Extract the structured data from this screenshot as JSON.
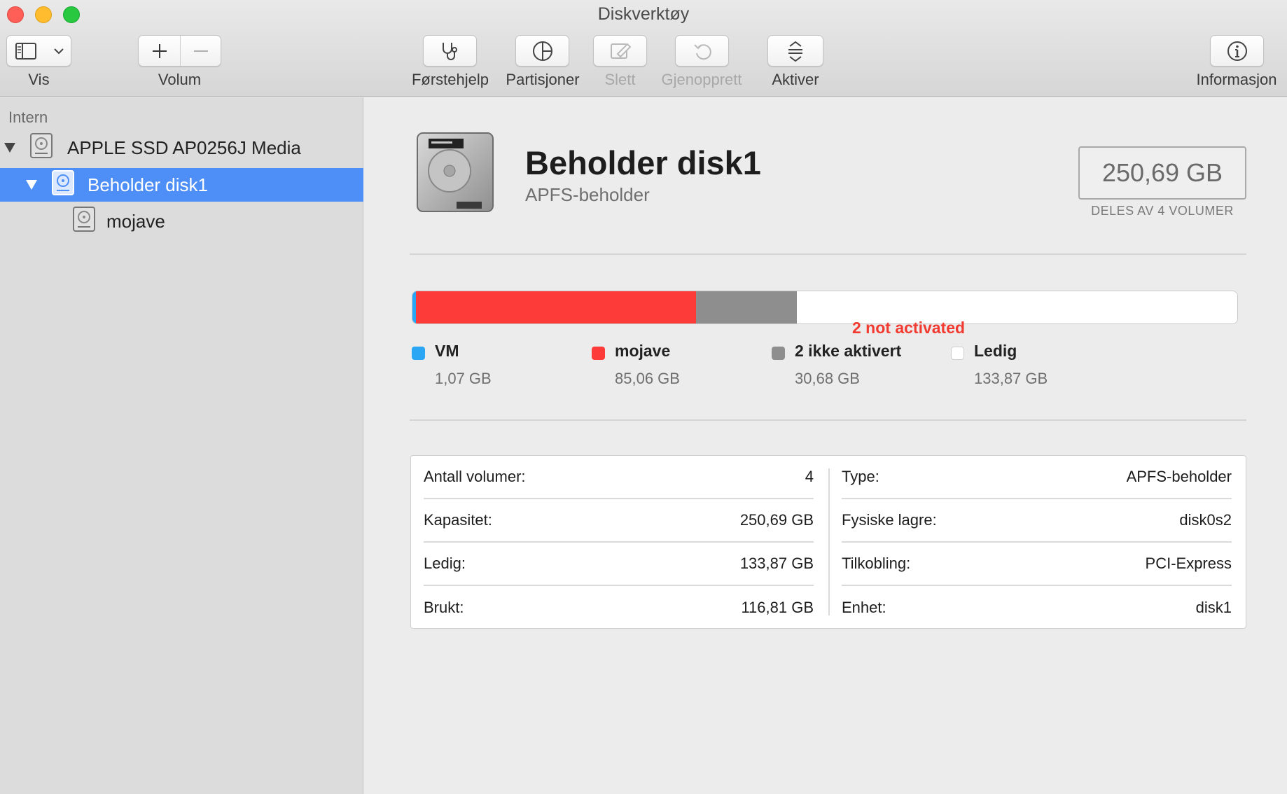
{
  "window": {
    "title": "Diskverktøy"
  },
  "toolbar": {
    "view_label": "Vis",
    "volume_label": "Volum",
    "first_aid_label": "Førstehjelp",
    "partition_label": "Partisjoner",
    "erase_label": "Slett",
    "restore_label": "Gjenopprett",
    "mount_label": "Aktiver",
    "info_label": "Informasjon"
  },
  "sidebar": {
    "section": "Intern",
    "items": [
      {
        "label": "APPLE SSD AP0256J Media"
      },
      {
        "label": "Beholder disk1"
      },
      {
        "label": "mojave"
      }
    ]
  },
  "main": {
    "title": "Beholder disk1",
    "subtitle": "APFS-beholder",
    "capacity": "250,69 GB",
    "capacity_caption": "DELES AV 4 VOLUMER",
    "annotation": "2 not activated"
  },
  "usage": {
    "total_gb": 250.69,
    "segments": [
      {
        "name": "VM",
        "size": "1,07 GB",
        "gb": 1.07,
        "color": "#2aa6f5"
      },
      {
        "name": "mojave",
        "size": "85,06 GB",
        "gb": 85.06,
        "color": "#fd3c3a"
      },
      {
        "name": "2 ikke aktivert",
        "size": "30,68 GB",
        "gb": 30.68,
        "color": "#8e8e8e"
      },
      {
        "name": "Ledig",
        "size": "133,87 GB",
        "gb": 133.87,
        "color": "#ffffff"
      }
    ]
  },
  "info": {
    "left": [
      {
        "label": "Antall volumer:",
        "value": "4"
      },
      {
        "label": "Kapasitet:",
        "value": "250,69 GB"
      },
      {
        "label": "Ledig:",
        "value": "133,87 GB"
      },
      {
        "label": "Brukt:",
        "value": "116,81 GB"
      }
    ],
    "right": [
      {
        "label": "Type:",
        "value": "APFS-beholder"
      },
      {
        "label": "Fysiske lagre:",
        "value": "disk0s2"
      },
      {
        "label": "Tilkobling:",
        "value": "PCI-Express"
      },
      {
        "label": "Enhet:",
        "value": "disk1"
      }
    ]
  }
}
